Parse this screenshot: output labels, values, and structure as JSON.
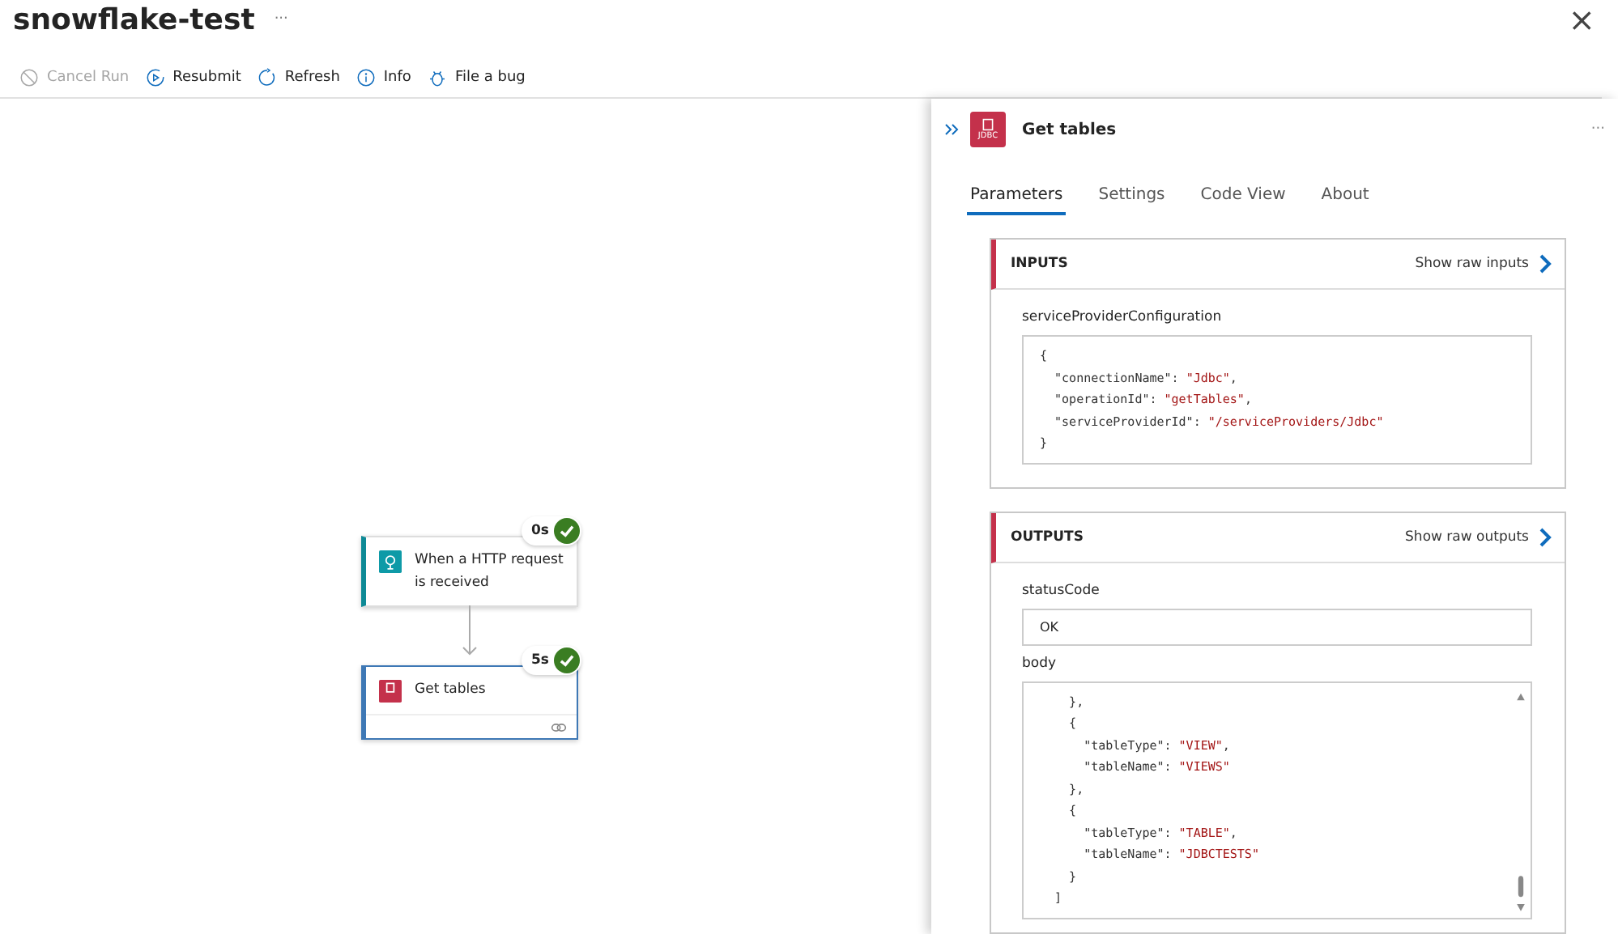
{
  "window": {
    "title": "snowflake-test",
    "more": "···",
    "close": "×"
  },
  "toolbar": [
    {
      "label": "Cancel Run",
      "kind": "cancel",
      "disabled": true
    },
    {
      "label": "Resubmit",
      "kind": "resubmit",
      "disabled": false
    },
    {
      "label": "Refresh",
      "kind": "refresh",
      "disabled": false
    },
    {
      "label": "Info",
      "kind": "info",
      "disabled": false
    },
    {
      "label": "File a bug",
      "kind": "bug",
      "disabled": false
    }
  ],
  "nodes": [
    {
      "kind": "trigger",
      "title": "When a HTTP request is received",
      "duration": "0s",
      "selected": false
    },
    {
      "kind": "jdbc",
      "title": "Get tables",
      "duration": "5s",
      "selected": true
    }
  ],
  "panel": {
    "title": "Get tables",
    "icon_text": "JDBC",
    "more": "···",
    "tabs": [
      {
        "label": "Parameters",
        "selected": true
      },
      {
        "label": "Settings",
        "selected": false
      },
      {
        "label": "Code View",
        "selected": false
      },
      {
        "label": "About",
        "selected": false
      }
    ],
    "sections": [
      {
        "heading": "INPUTS",
        "link": "Show raw inputs",
        "fields": [
          {
            "label": "serviceProviderConfiguration",
            "kind": "code",
            "lines": [
              {
                "text": "{"
              },
              {
                "text": "  \"connectionName\": ",
                "value": "\"Jdbc\"",
                "tail": ","
              },
              {
                "text": "  \"operationId\": ",
                "value": "\"getTables\"",
                "tail": ","
              },
              {
                "text": "  \"serviceProviderId\": ",
                "value": "\"/serviceProviders/Jdbc\""
              },
              {
                "text": "}"
              }
            ]
          }
        ]
      },
      {
        "heading": "OUTPUTS",
        "link": "Show raw outputs",
        "fields": [
          {
            "label": "statusCode",
            "kind": "value",
            "value": "OK"
          },
          {
            "label": "body",
            "kind": "scrollcode",
            "lines": [
              {
                "text": "    },"
              },
              {
                "text": "    {"
              },
              {
                "text": "      \"tableType\": ",
                "value": "\"VIEW\"",
                "tail": ","
              },
              {
                "text": "      \"tableName\": ",
                "value": "\"VIEWS\""
              },
              {
                "text": "    },"
              },
              {
                "text": "    {"
              },
              {
                "text": "      \"tableType\": ",
                "value": "\"TABLE\"",
                "tail": ","
              },
              {
                "text": "      \"tableName\": ",
                "value": "\"JDBCTESTS\""
              },
              {
                "text": "    }"
              },
              {
                "text": "  ]"
              }
            ]
          }
        ]
      }
    ]
  }
}
